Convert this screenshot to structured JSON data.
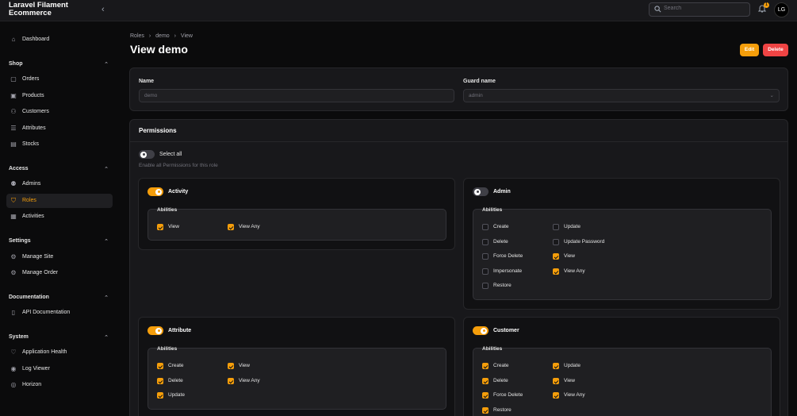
{
  "app": {
    "brand": "Laravel Filament Ecommerce"
  },
  "topbar": {
    "search_placeholder": "Search",
    "notification_count": "1",
    "avatar_initials": "LG"
  },
  "sidebar": {
    "dashboard": "Dashboard",
    "groups": {
      "shop": "Shop",
      "access": "Access",
      "settings": "Settings",
      "documentation": "Documentation",
      "system": "System"
    },
    "items": {
      "orders": "Orders",
      "products": "Products",
      "customers": "Customers",
      "attributes": "Attributes",
      "stocks": "Stocks",
      "admins": "Admins",
      "roles": "Roles",
      "activities": "Activities",
      "manage_site": "Manage Site",
      "manage_order": "Manage Order",
      "api_documentation": "API Documentation",
      "application_health": "Application Health",
      "log_viewer": "Log Viewer",
      "horizon": "Horizon"
    }
  },
  "breadcrumb": [
    "Roles",
    "demo",
    "View"
  ],
  "page": {
    "title": "View demo",
    "edit_label": "Edit",
    "delete_label": "Delete"
  },
  "form": {
    "name_label": "Name",
    "name_value": "demo",
    "guard_label": "Guard name",
    "guard_value": "admin"
  },
  "permissions": {
    "title": "Permissions",
    "select_all": "Select all",
    "select_all_hint": "Enable all Permissions for this role",
    "abilities_label": "Abilities",
    "sections": {
      "activity": {
        "name": "Activity",
        "enabled": true,
        "view": "View",
        "view_any": "View Any"
      },
      "admin": {
        "name": "Admin",
        "enabled": false,
        "create": "Create",
        "update": "Update",
        "delete": "Delete",
        "update_password": "Update Password",
        "force_delete": "Force Delete",
        "view": "View",
        "impersonate": "Impersonate",
        "view_any": "View Any",
        "restore": "Restore"
      },
      "attribute": {
        "name": "Attribute",
        "enabled": true,
        "create": "Create",
        "view": "View",
        "delete": "Delete",
        "view_any": "View Any",
        "update": "Update"
      },
      "customer": {
        "name": "Customer",
        "enabled": true,
        "create": "Create",
        "update": "Update",
        "delete": "Delete",
        "view": "View",
        "force_delete": "Force Delete",
        "view_any": "View Any",
        "restore": "Restore"
      }
    }
  },
  "colors": {
    "accent": "#f59e0b",
    "danger": "#ef4444",
    "background": "#0b0b0c",
    "card": "#18181b"
  }
}
